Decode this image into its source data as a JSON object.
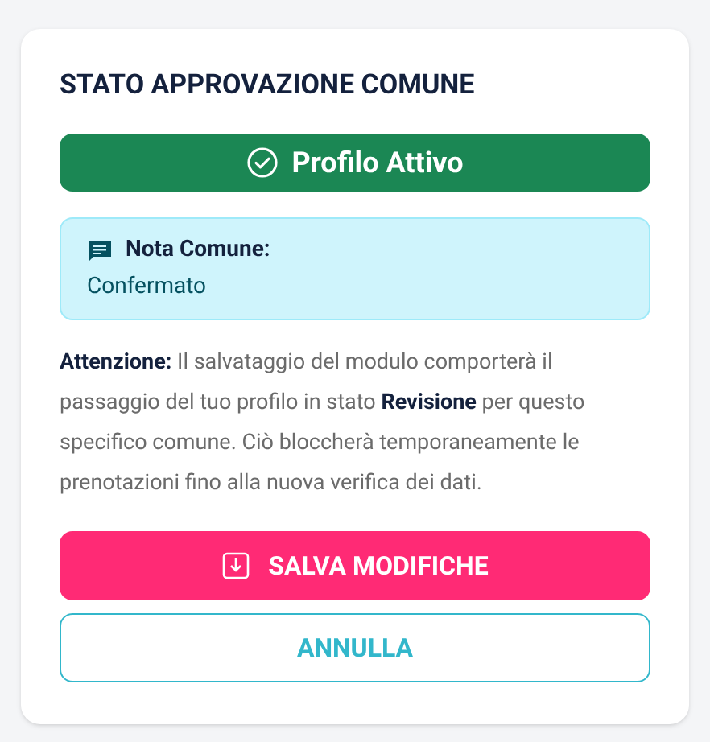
{
  "card": {
    "title": "STATO APPROVAZIONE COMUNE",
    "status": {
      "kind": "active",
      "label": "Profilo Attivo"
    },
    "note": {
      "title": "Nota Comune:",
      "text": "Confermato"
    },
    "warning": "**Attenzione:** Il salvataggio del modulo comporterà il passaggio del tuo profilo in stato **Revisione** per questo specifico comune. Ciò bloccherà temporaneamente le prenotazioni fino alla nuova verifica dei dati.",
    "buttons": [
      {
        "kind": "primary",
        "label": "SALVA MODIFICHE"
      },
      {
        "kind": "outline",
        "label": "ANNULLA"
      }
    ]
  }
}
